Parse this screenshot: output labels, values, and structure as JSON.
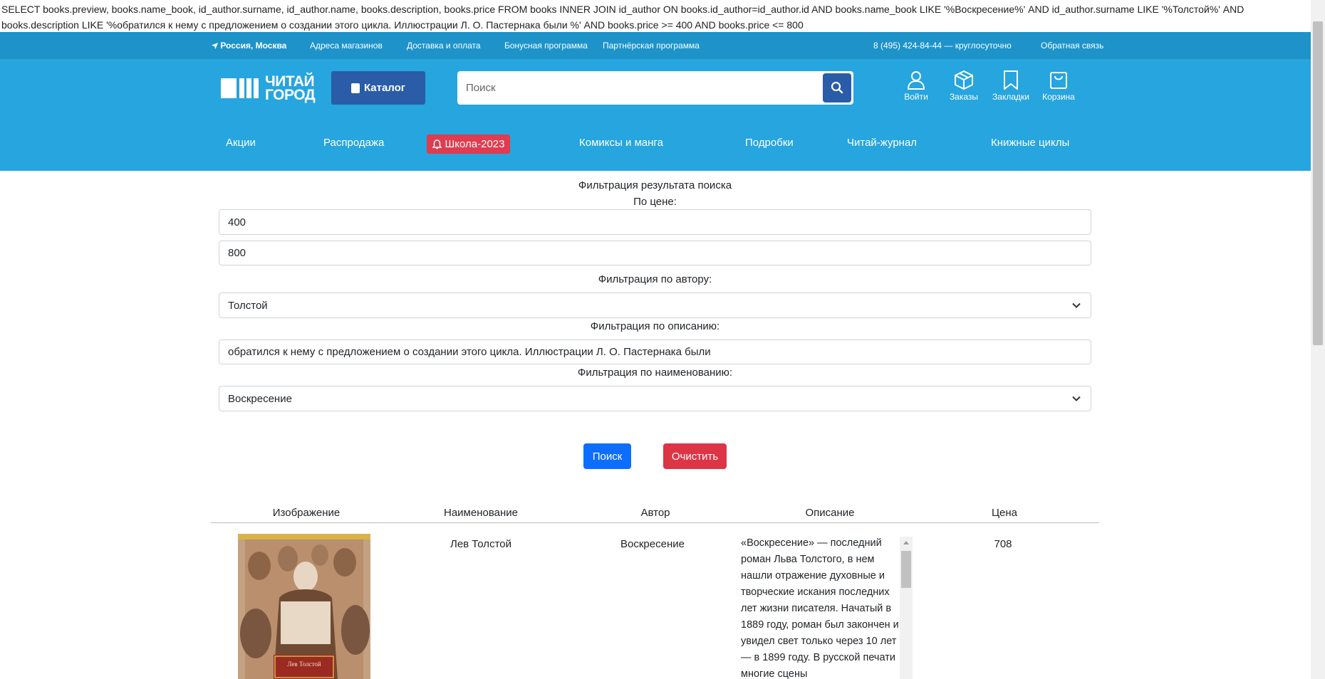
{
  "sql_query": "SELECT books.preview, books.name_book, id_author.surname, id_author.name, books.description, books.price FROM books INNER JOIN id_author ON books.id_author=id_author.id AND books.name_book LIKE '%Воскресение%' AND id_author.surname LIKE '%Толстой%' AND books.description LIKE '%обратился к нему с предложением о создании этого цикла. Иллюстрации Л. О. Пастернака были %' AND books.price >= 400 AND books.price <= 800",
  "topbar": {
    "location": "Россия, Москва",
    "links": [
      "Адреса магазинов",
      "Доставка и оплата",
      "Бонусная программа",
      "Партнёрская программа"
    ],
    "phone": "8 (495) 424-84-44 — круглосуточно",
    "feedback": "Обратная связь"
  },
  "header": {
    "logo_line1": "ЧИТАЙ",
    "logo_line2": "ГОРОД",
    "catalog_label": "Каталог",
    "search_placeholder": "Поиск",
    "icons": [
      {
        "name": "user-icon",
        "label": "Войти"
      },
      {
        "name": "box-icon",
        "label": "Заказы"
      },
      {
        "name": "bookmark-icon",
        "label": "Закладки"
      },
      {
        "name": "cart-icon",
        "label": "Корзина"
      }
    ]
  },
  "nav": {
    "items": [
      "Акции",
      "Распродажа",
      "Школа-2023",
      "Комиксы и манга",
      "Подробки",
      "Читай-журнал",
      "Книжные циклы"
    ]
  },
  "filter": {
    "title": "Фильтрация результата поиска",
    "price_label": "По цене:",
    "price_min": "400",
    "price_max": "800",
    "author_label": "Фильтрация по автору:",
    "author_value": "Толстой",
    "description_label": "Фильтрация по описанию:",
    "description_value": "обратился к нему с предложением о создании этого цикла. Иллюстрации Л. О. Пастернака были",
    "name_label": "Фильтрация по наименованию:",
    "name_value": "Воскресение",
    "search_button": "Поиск",
    "clear_button": "Очистить"
  },
  "table": {
    "headers": [
      "Изображение",
      "Наименование",
      "Автор",
      "Описание",
      "Цена"
    ],
    "rows": [
      {
        "cover_author": "Лев Толстой",
        "name": "Лев Толстой",
        "author": "Воскресение",
        "description": "«Воскресение» — последний роман Льва Толстого, в нем нашли отражение духовные и творческие искания последних лет жизни писателя. Начатый в 1889 году, роман был закончен и увидел свет только через 10 лет — в 1899 году. В русской печати многие сцены",
        "price": "708"
      }
    ]
  },
  "colors": {
    "topbar": "#1e93c9",
    "header": "#26a5df",
    "catalog_button": "#2a5ca8",
    "school_badge": "#e03b4f",
    "search_button": "#0d6efd",
    "clear_button": "#dc3545"
  }
}
